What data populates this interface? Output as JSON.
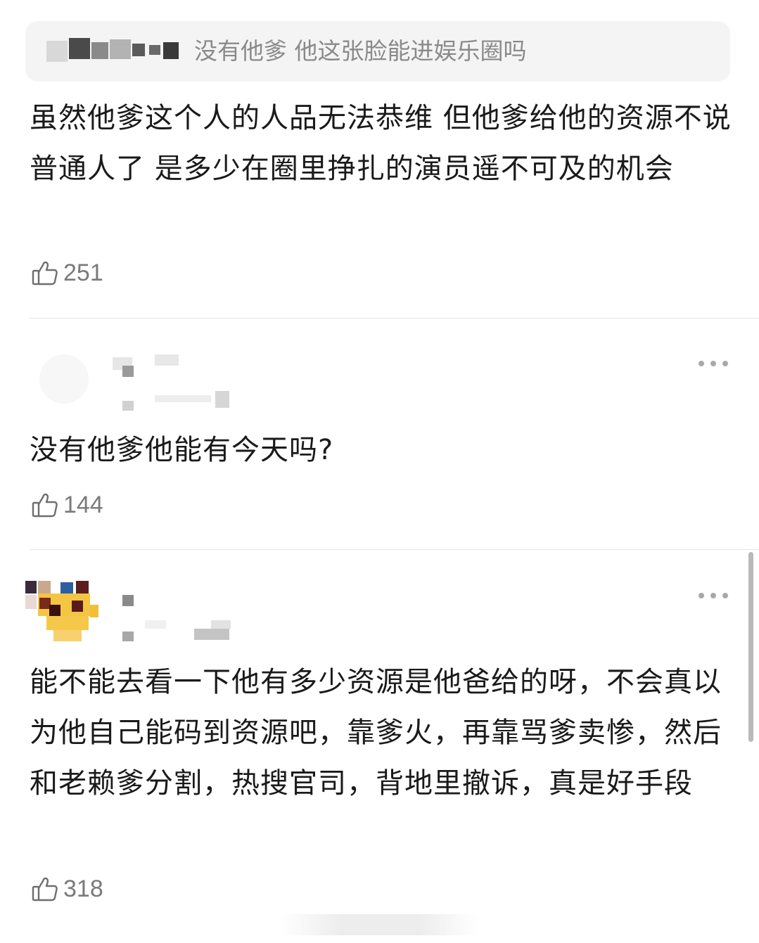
{
  "quoted_reply": {
    "text": "没有他爹 他这张脸能进娱乐圈吗"
  },
  "comments": [
    {
      "text": "虽然他爹这个人的人品无法恭维 但他爹给他的资源不说普通人了  是多少在圈里挣扎的演员遥不可及的机会",
      "likes": "251"
    },
    {
      "text": "没有他爹他能有今天吗?",
      "likes": "144"
    },
    {
      "text": "能不能去看一下他有多少资源是他爸给的呀，不会真以为他自己能码到资源吧，靠爹火，再靠骂爹卖惨，然后和老赖爹分割，热搜官司，背地里撤诉，真是好手段",
      "likes": "318"
    }
  ],
  "icons": {
    "like": "thumbs-up-icon",
    "more": "more-dots-icon"
  },
  "colors": {
    "quote_bg": "#f4f4f4",
    "quote_text": "#8a8a8a",
    "body_text": "#1a1a1a",
    "meta_text": "#7a7a7a"
  }
}
